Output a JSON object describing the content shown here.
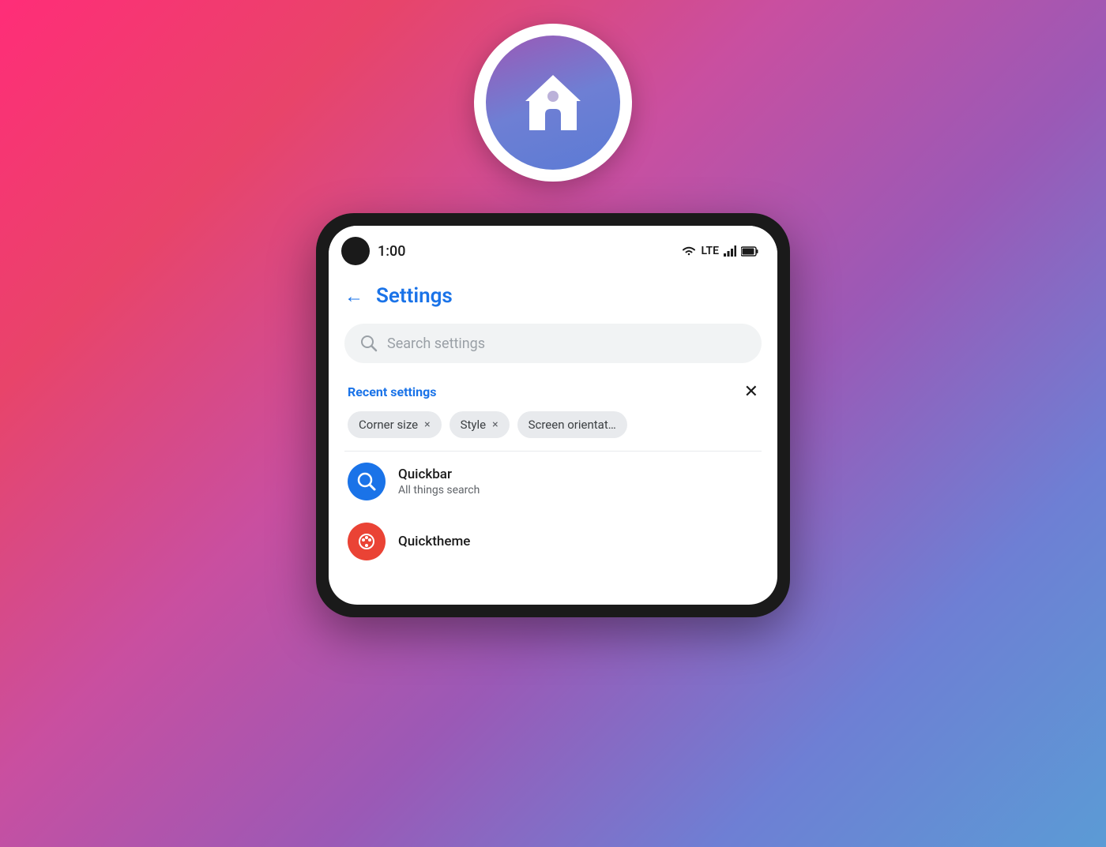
{
  "background": {
    "gradient_start": "#ff2d78",
    "gradient_end": "#5b9bd5"
  },
  "app_icon": {
    "alt": "Home Launcher App Icon"
  },
  "status_bar": {
    "time": "1:00",
    "lte_label": "LTE"
  },
  "header": {
    "back_label": "←",
    "title": "Settings"
  },
  "search": {
    "placeholder": "Search settings"
  },
  "recent_settings": {
    "title": "Recent settings",
    "close_label": "✕",
    "chips": [
      {
        "label": "Corner size",
        "close": "×"
      },
      {
        "label": "Style",
        "close": "×"
      },
      {
        "label": "Screen orientat…",
        "close": ""
      }
    ]
  },
  "list_items": [
    {
      "icon_type": "blue",
      "icon_char": "🔍",
      "title": "Quickbar",
      "subtitle": "All things search"
    },
    {
      "icon_type": "red",
      "icon_char": "🎨",
      "title": "Quicktheme",
      "subtitle": ""
    }
  ]
}
